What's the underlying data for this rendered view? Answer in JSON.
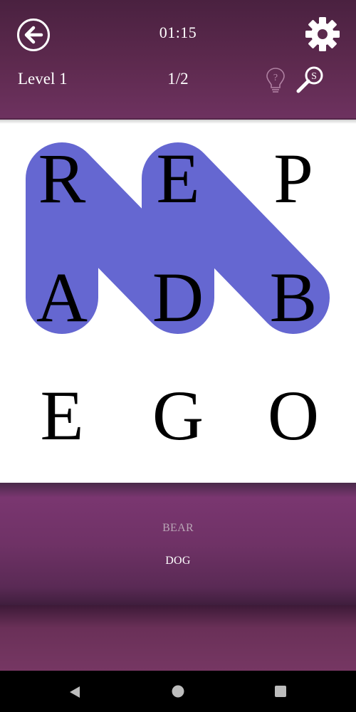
{
  "header": {
    "timer": "01:15",
    "level_label": "Level 1",
    "progress": "1/2",
    "back_icon": "back-arrow-icon",
    "settings_icon": "gear-icon",
    "hint_icon": "lightbulb-question-icon",
    "search_icon": "magnifier-s-icon",
    "search_icon_letter": "S",
    "hint_icon_letter": "?"
  },
  "board": {
    "rows": 3,
    "cols": 3,
    "letters": [
      "R",
      "E",
      "P",
      "A",
      "D",
      "B",
      "E",
      "G",
      "O"
    ],
    "highlight_color": "#6567d1",
    "selection_path": [
      3,
      0,
      4,
      1,
      5
    ]
  },
  "words": [
    {
      "text": "BEAR",
      "found": true
    },
    {
      "text": "DOG",
      "found": false
    }
  ],
  "colors": {
    "header": "#5e2a4f",
    "word_panel": "#6f3266",
    "found_word": "#b9a6b6",
    "pending_word": "#ffffff"
  },
  "navbar": {
    "back_icon": "triangle-back-icon",
    "home_icon": "circle-home-icon",
    "recent_icon": "square-recents-icon"
  }
}
